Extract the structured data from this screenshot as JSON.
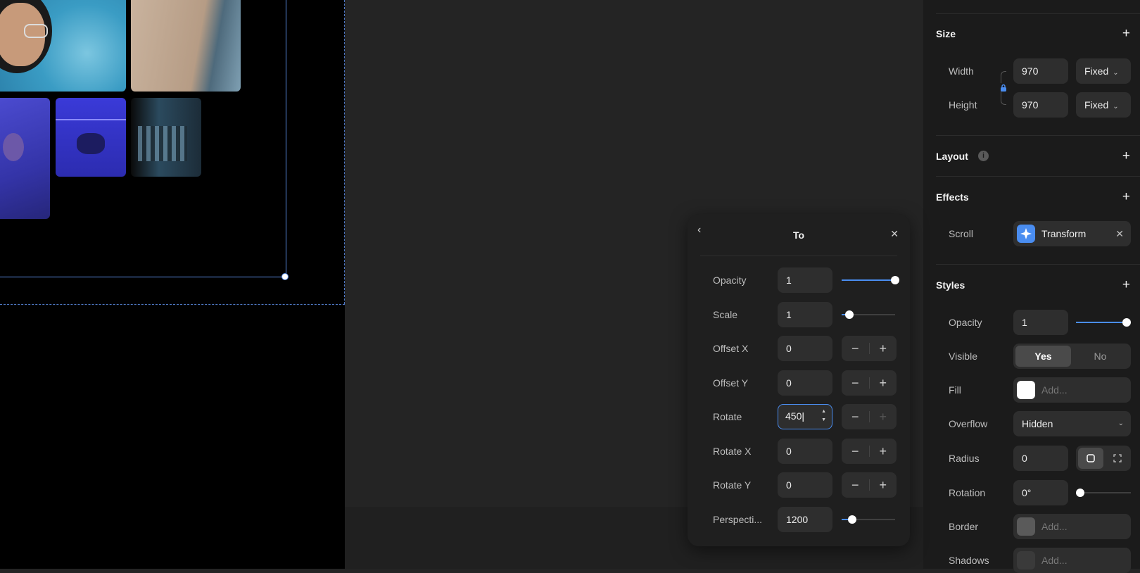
{
  "popover": {
    "title": "To",
    "rows": [
      {
        "label": "Opacity",
        "value": "1",
        "control": "slider",
        "fraction": 1.0
      },
      {
        "label": "Scale",
        "value": "1",
        "control": "slider",
        "fraction": 0.15
      },
      {
        "label": "Offset X",
        "value": "0",
        "control": "stepper"
      },
      {
        "label": "Offset Y",
        "value": "0",
        "control": "stepper"
      },
      {
        "label": "Rotate",
        "value": "450",
        "control": "stepper",
        "focused": true
      },
      {
        "label": "Rotate X",
        "value": "0",
        "control": "stepper"
      },
      {
        "label": "Rotate Y",
        "value": "0",
        "control": "stepper"
      },
      {
        "label": "Perspecti...",
        "value": "1200",
        "control": "slider",
        "fraction": 0.2
      }
    ]
  },
  "panel": {
    "size": {
      "title": "Size",
      "width_label": "Width",
      "width_value": "970",
      "width_mode": "Fixed",
      "height_label": "Height",
      "height_value": "970",
      "height_mode": "Fixed"
    },
    "layout": {
      "title": "Layout"
    },
    "effects": {
      "title": "Effects",
      "scroll_label": "Scroll",
      "scroll_value": "Transform"
    },
    "styles": {
      "title": "Styles",
      "opacity_label": "Opacity",
      "opacity_value": "1",
      "opacity_fraction": 1.0,
      "visible_label": "Visible",
      "visible_yes": "Yes",
      "visible_no": "No",
      "fill_label": "Fill",
      "fill_placeholder": "Add...",
      "overflow_label": "Overflow",
      "overflow_value": "Hidden",
      "radius_label": "Radius",
      "radius_value": "0",
      "rotation_label": "Rotation",
      "rotation_value": "0°",
      "rotation_fraction": 0.0,
      "border_label": "Border",
      "border_placeholder": "Add...",
      "shadows_label": "Shadows",
      "shadows_placeholder": "Add..."
    }
  },
  "colors": {
    "accent": "#4a8df0",
    "panel_bg": "#1b1b1b",
    "canvas_bg": "#242424"
  }
}
